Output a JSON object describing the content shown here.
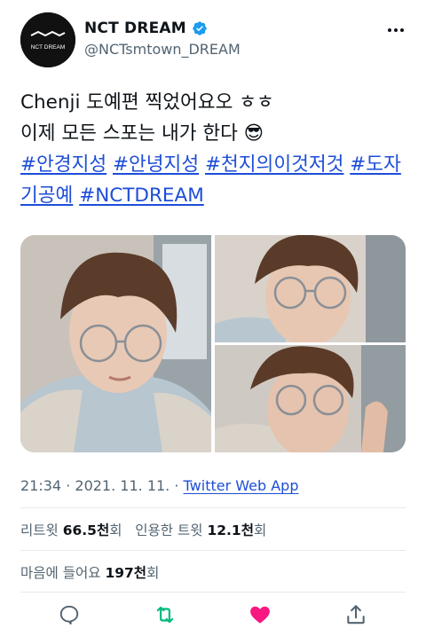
{
  "account": {
    "avatar_text": "NCT DREAM",
    "display_name": "NCT DREAM",
    "handle": "@NCTsmtown_DREAM",
    "verified": true
  },
  "tweet": {
    "line1": "Chenji 도예편 찍었어요오 ㅎㅎ",
    "line2_text": "이제 모든 스포는 내가 한다 ",
    "line2_emoji": "😎",
    "hashtags": [
      "#안경지성",
      "#안녕지성",
      "#천지의이것저것",
      "#도자기공예",
      "#NCTDREAM"
    ]
  },
  "meta": {
    "time": "21:34",
    "separator": "·",
    "date": "2021. 11. 11.",
    "source": "Twitter Web App"
  },
  "stats": {
    "retweets_label": "리트윗",
    "retweets_value": "66.5천",
    "retweets_suffix": "회",
    "quotes_label": "인용한 트윗",
    "quotes_value": "12.1천",
    "quotes_suffix": "회",
    "likes_label": "마음에 들어요",
    "likes_value": "197천",
    "likes_suffix": "회"
  },
  "icons": {
    "verified": "verified-badge-icon",
    "more": "more-options-icon",
    "reply": "reply-icon",
    "retweet": "retweet-icon",
    "like": "heart-icon",
    "share": "share-icon"
  },
  "colors": {
    "accent": "#1d9bf0",
    "link": "#1d4ed8",
    "retweet": "#00ba7c",
    "like": "#f91880",
    "muted": "#536471"
  }
}
